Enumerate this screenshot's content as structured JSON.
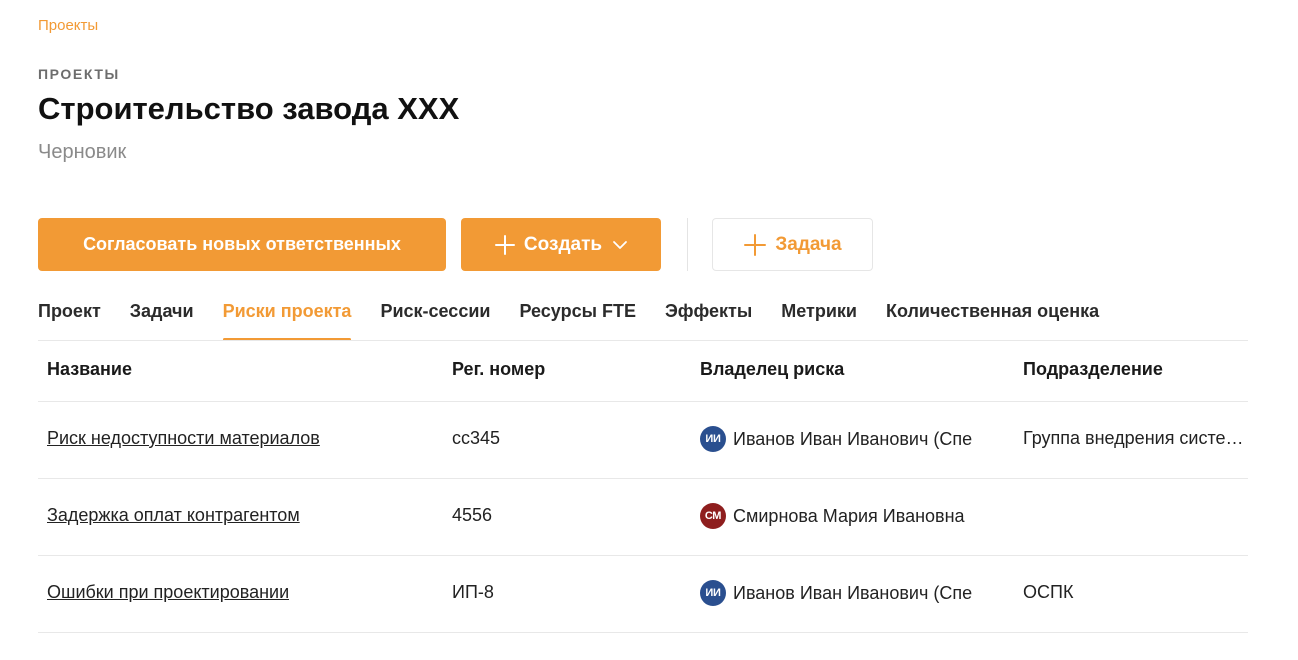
{
  "breadcrumb": "Проекты",
  "section_label": "ПРОЕКТЫ",
  "title": "Строительство завода XXX",
  "status": "Черновик",
  "actions": {
    "approve_label": "Согласовать новых ответственных",
    "create_label": "Создать",
    "task_label": "Задача"
  },
  "tabs": [
    {
      "label": "Проект"
    },
    {
      "label": "Задачи"
    },
    {
      "label": "Риски проекта",
      "active": true
    },
    {
      "label": "Риск-сессии"
    },
    {
      "label": "Ресурсы FTE"
    },
    {
      "label": "Эффекты"
    },
    {
      "label": "Метрики"
    },
    {
      "label": "Количественная оценка"
    }
  ],
  "table": {
    "columns": [
      "Название",
      "Рег. номер",
      "Владелец риска",
      "Подразделение"
    ],
    "rows": [
      {
        "name": "Риск недоступности материалов",
        "reg": "cc345",
        "owner_initials": "ИИ",
        "owner": "Иванов Иван Иванович (Спе",
        "owner_color": "#2a4f8f",
        "dept": "Группа внедрения системы"
      },
      {
        "name": "Задержка оплат контрагентом",
        "reg": "4556",
        "owner_initials": "СМ",
        "owner": "Смирнова Мария Ивановна",
        "owner_color": "#8e1e1e",
        "dept": ""
      },
      {
        "name": "Ошибки при проектировании",
        "reg": "ИП-8",
        "owner_initials": "ИИ",
        "owner": "Иванов Иван Иванович (Спе",
        "owner_color": "#2a4f8f",
        "dept": "ОСПК"
      }
    ]
  },
  "colors": {
    "accent": "#f29a35",
    "text": "#1f1f1f",
    "muted": "#8a8a8a",
    "border": "#e8e8e8"
  },
  "icons": {
    "create_plus": "plus-icon",
    "create_chevron": "chevron-down-icon",
    "task_plus": "plus-icon"
  }
}
